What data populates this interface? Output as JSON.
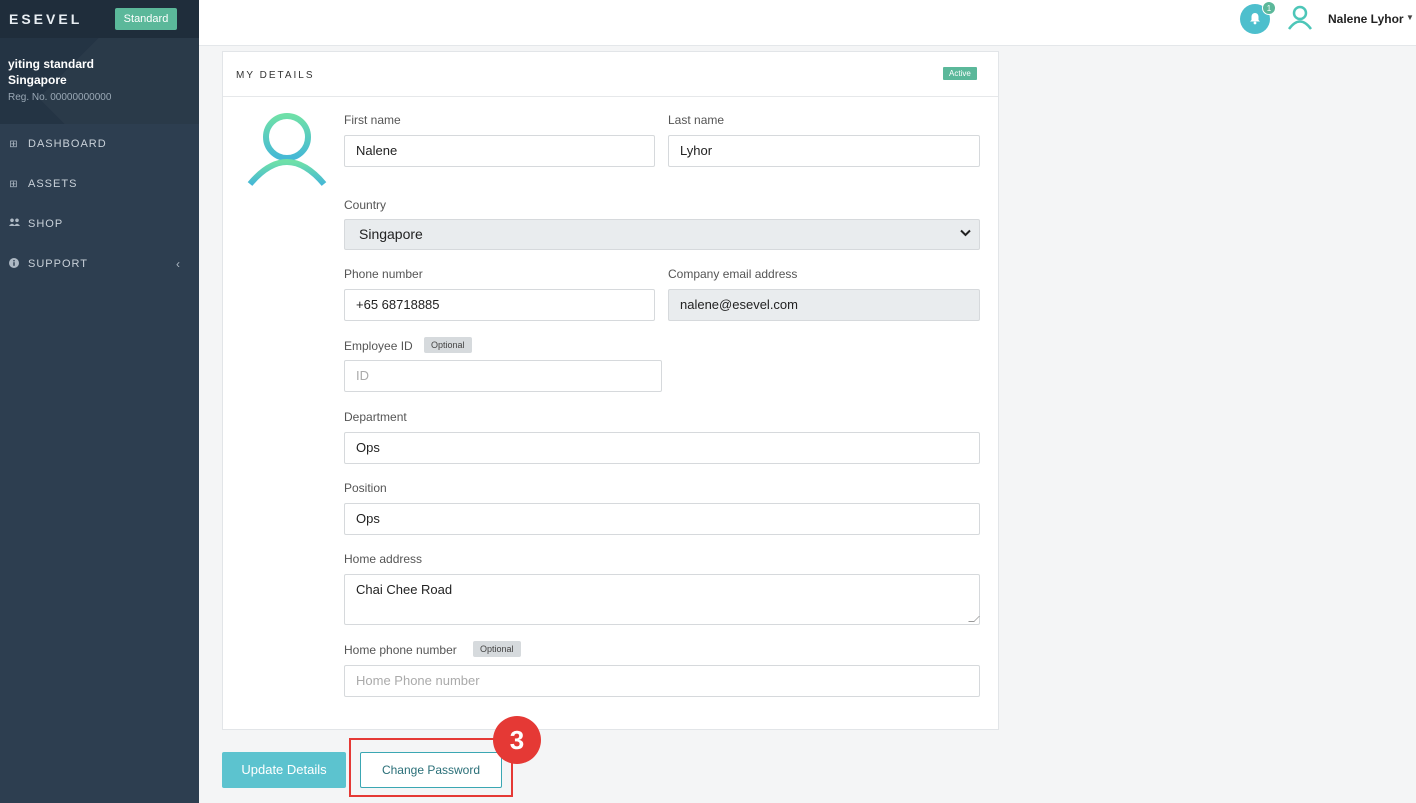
{
  "sidebar": {
    "brand": "ESEVEL",
    "plan_badge": "Standard",
    "org_name_line1": "yiting standard",
    "org_name_line2": "Singapore",
    "org_reg": "Reg. No. 00000000000",
    "items": [
      {
        "label": "DASHBOARD",
        "icon": "grid-icon"
      },
      {
        "label": "ASSETS",
        "icon": "grid-icon"
      },
      {
        "label": "SHOP",
        "icon": "users-icon"
      },
      {
        "label": "SUPPORT",
        "icon": "info-icon"
      }
    ]
  },
  "header": {
    "notification_count": "1",
    "user_name": "Nalene Lyhor"
  },
  "card": {
    "title": "MY DETAILS",
    "status": "Active"
  },
  "form": {
    "first_name_label": "First name",
    "first_name_value": "Nalene",
    "last_name_label": "Last name",
    "last_name_value": "Lyhor",
    "country_label": "Country",
    "country_value": "Singapore",
    "phone_label": "Phone number",
    "phone_value": "+65 68718885",
    "email_label": "Company email address",
    "email_value": "nalene@esevel.com",
    "employee_id_label": "Employee ID",
    "optional_badge": "Optional",
    "employee_id_placeholder": "ID",
    "department_label": "Department",
    "department_value": "Ops",
    "position_label": "Position",
    "position_value": "Ops",
    "home_address_label": "Home address",
    "home_address_value": "Chai Chee Road",
    "home_phone_label": "Home phone number",
    "home_phone_placeholder": "Home Phone number"
  },
  "actions": {
    "update_label": "Update Details",
    "change_password_label": "Change Password",
    "step_number": "3"
  },
  "colors": {
    "sidebar_bg": "#2d3e50",
    "accent_teal": "#5cc3cf",
    "status_green": "#5bb89a",
    "highlight_red": "#e53935"
  }
}
